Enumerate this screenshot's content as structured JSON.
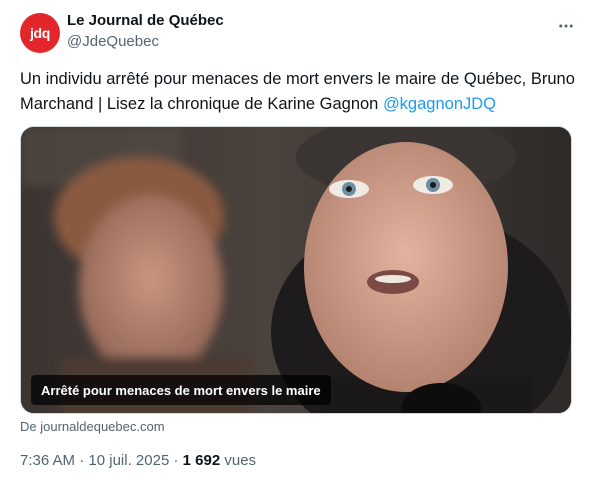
{
  "author": {
    "avatar_text": "jdq",
    "name": "Le Journal de Québec",
    "handle": "@JdeQuebec"
  },
  "tweet": {
    "text": "Un individu arrêté pour menaces de mort envers le maire de Québec, Bruno Marchand | Lisez la chronique de Karine Gagnon ",
    "mention": "@kgagnonJDQ"
  },
  "card": {
    "caption": "Arrêté pour menaces de mort envers le maire",
    "source": "De journaldequebec.com"
  },
  "meta": {
    "time": "7:36 AM",
    "date": "10 juil. 2025",
    "sep": " · ",
    "views_count": "1 692",
    "views_label": " vues"
  },
  "colors": {
    "accent": "#1d9bf0",
    "brand": "#e3262b",
    "muted": "#536471"
  },
  "icons": [
    "more-options-icon"
  ]
}
